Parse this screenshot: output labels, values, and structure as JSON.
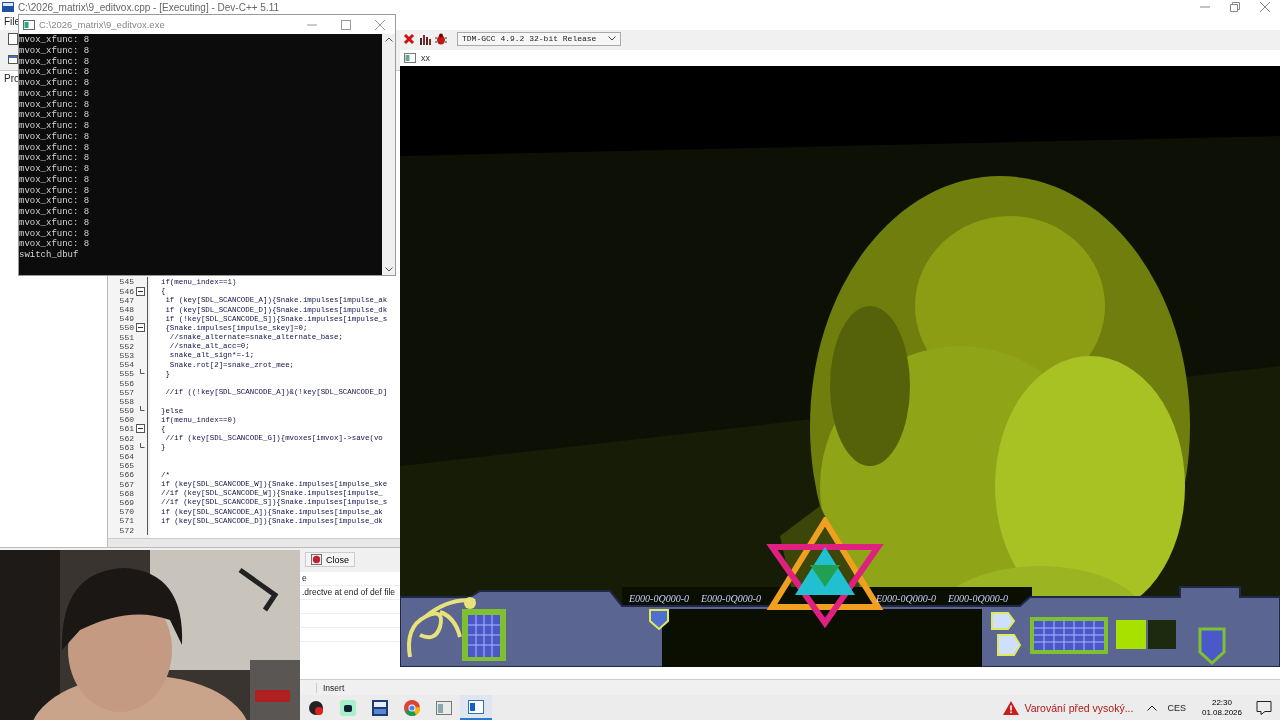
{
  "ide": {
    "title": "C:\\2026_matrix\\9_editvox.cpp - [Executing] - Dev-C++ 5.11",
    "menu": [
      "File"
    ],
    "side_label": "Pro",
    "compiler": "TDM-GCC 4.9.2 32-bit Release",
    "code_lines": [
      {
        "number": "545",
        "kind": "plain",
        "text": "if(menu_index==1)"
      },
      {
        "number": "546",
        "kind": "block-start",
        "text": "{"
      },
      {
        "number": "547",
        "kind": "plain",
        "text": " if (key[SDL_SCANCODE_A]){Snake.impulses[impulse_ak"
      },
      {
        "number": "548",
        "kind": "plain",
        "text": " if (key[SDL_SCANCODE_D]){Snake.impulses[impulse_dk"
      },
      {
        "number": "549",
        "kind": "plain",
        "text": " if (!key[SDL_SCANCODE_S]){Snake.impulses[impulse_s"
      },
      {
        "number": "550",
        "kind": "block-start",
        "text": " {Snake.impulses[impulse_skey]=0;"
      },
      {
        "number": "551",
        "kind": "plain",
        "text": "  //snake_alternate=snake_alternate_base;"
      },
      {
        "number": "552",
        "kind": "plain",
        "text": "  //snake_alt_acc=0;"
      },
      {
        "number": "553",
        "kind": "plain",
        "text": "  snake_alt_sign*=-1;"
      },
      {
        "number": "554",
        "kind": "plain",
        "text": "  Snake.rot[2]=snake_zrot_mee;"
      },
      {
        "number": "555",
        "kind": "block-end",
        "text": " }"
      },
      {
        "number": "556",
        "kind": "plain"
      },
      {
        "number": "557",
        "kind": "plain",
        "text": " //if ((!key[SDL_SCANCODE_A])&(!key[SDL_SCANCODE_D]"
      },
      {
        "number": "558",
        "kind": "plain"
      },
      {
        "number": "559",
        "kind": "block-end",
        "text": "}else"
      },
      {
        "number": "560",
        "kind": "plain",
        "text": "if(menu_index==0)"
      },
      {
        "number": "561",
        "kind": "block-start",
        "text": "{"
      },
      {
        "number": "562",
        "kind": "plain",
        "text": " //if (key[SDL_SCANCODE_G]){mvoxes[imvox]->save(vo"
      },
      {
        "number": "563",
        "kind": "block-end",
        "text": "}"
      },
      {
        "number": "564",
        "kind": "plain"
      },
      {
        "number": "565",
        "kind": "plain"
      },
      {
        "number": "566",
        "kind": "plain",
        "text": "/*"
      },
      {
        "number": "567",
        "kind": "plain",
        "text": "if (key[SDL_SCANCODE_W]){Snake.impulses[impulse_ske"
      },
      {
        "number": "568",
        "kind": "plain",
        "text": "//if (key[SDL_SCANCODE_W]){Snake.impulses[impulse_"
      },
      {
        "number": "569",
        "kind": "plain",
        "text": "//if (key[SDL_SCANCODE_S]){Snake.impulses[impulse_s"
      },
      {
        "number": "570",
        "kind": "plain",
        "text": "if (key[SDL_SCANCODE_A]){Snake.impulses[impulse_ak"
      },
      {
        "number": "571",
        "kind": "plain",
        "text": "if (key[SDL_SCANCODE_D]){Snake.impulses[impulse_dk"
      },
      {
        "number": "572",
        "kind": "plain"
      }
    ],
    "close_button": "Close",
    "messages": [
      "e",
      ".drectve at end of def file"
    ],
    "status": "Insert"
  },
  "console": {
    "title": "C:\\2026_matrix\\9_editvox.exe",
    "lines": [
      "mvox_xfunc: 8",
      "mvox_xfunc: 8",
      "mvox_xfunc: 8",
      "mvox_xfunc: 8",
      "mvox_xfunc: 8",
      "mvox_xfunc: 8",
      "mvox_xfunc: 8",
      "mvox_xfunc: 8",
      "mvox_xfunc: 8",
      "mvox_xfunc: 8",
      "mvox_xfunc: 8",
      "mvox_xfunc: 8",
      "mvox_xfunc: 8",
      "mvox_xfunc: 8",
      "mvox_xfunc: 8",
      "mvox_xfunc: 8",
      "mvox_xfunc: 8",
      "mvox_xfunc: 8",
      "mvox_xfunc: 8",
      "mvox_xfunc: 8",
      "switch_dbuf"
    ]
  },
  "game": {
    "title": "xx",
    "readouts": [
      "E000-0Q000-0",
      "E000-0Q000-0",
      "E000-0Q000-0",
      "E000-0Q000-0"
    ]
  },
  "taskbar": {
    "apps": [
      {
        "kind": "record",
        "selected": false
      },
      {
        "kind": "chat",
        "selected": false
      },
      {
        "kind": "devcpp",
        "selected": false
      },
      {
        "kind": "browser",
        "selected": false
      },
      {
        "kind": "window",
        "selected": false
      },
      {
        "kind": "console",
        "selected": true
      }
    ],
    "warning": "Varování před vysoký...",
    "language": "CES",
    "time": "22:30",
    "date": "01.08.2026"
  }
}
